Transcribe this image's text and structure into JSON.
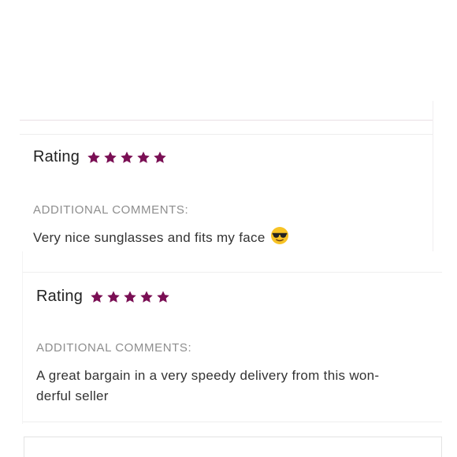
{
  "colors": {
    "star": "#7a0f54",
    "text": "#222222",
    "muted": "#8e8e8e"
  },
  "reviews": [
    {
      "rating_label": "Rating",
      "stars": 5,
      "comments_heading": "ADDITIONAL COMMENTS:",
      "comment": "Very nice sunglasses and fits my face",
      "emoji_icon": "sunglasses-emoji"
    },
    {
      "rating_label": "Rating",
      "stars": 5,
      "comments_heading": "ADDITIONAL COMMENTS:",
      "comment_lines": [
        "A great bargain in a very speedy delivery from this won-",
        "derful seller"
      ]
    }
  ]
}
